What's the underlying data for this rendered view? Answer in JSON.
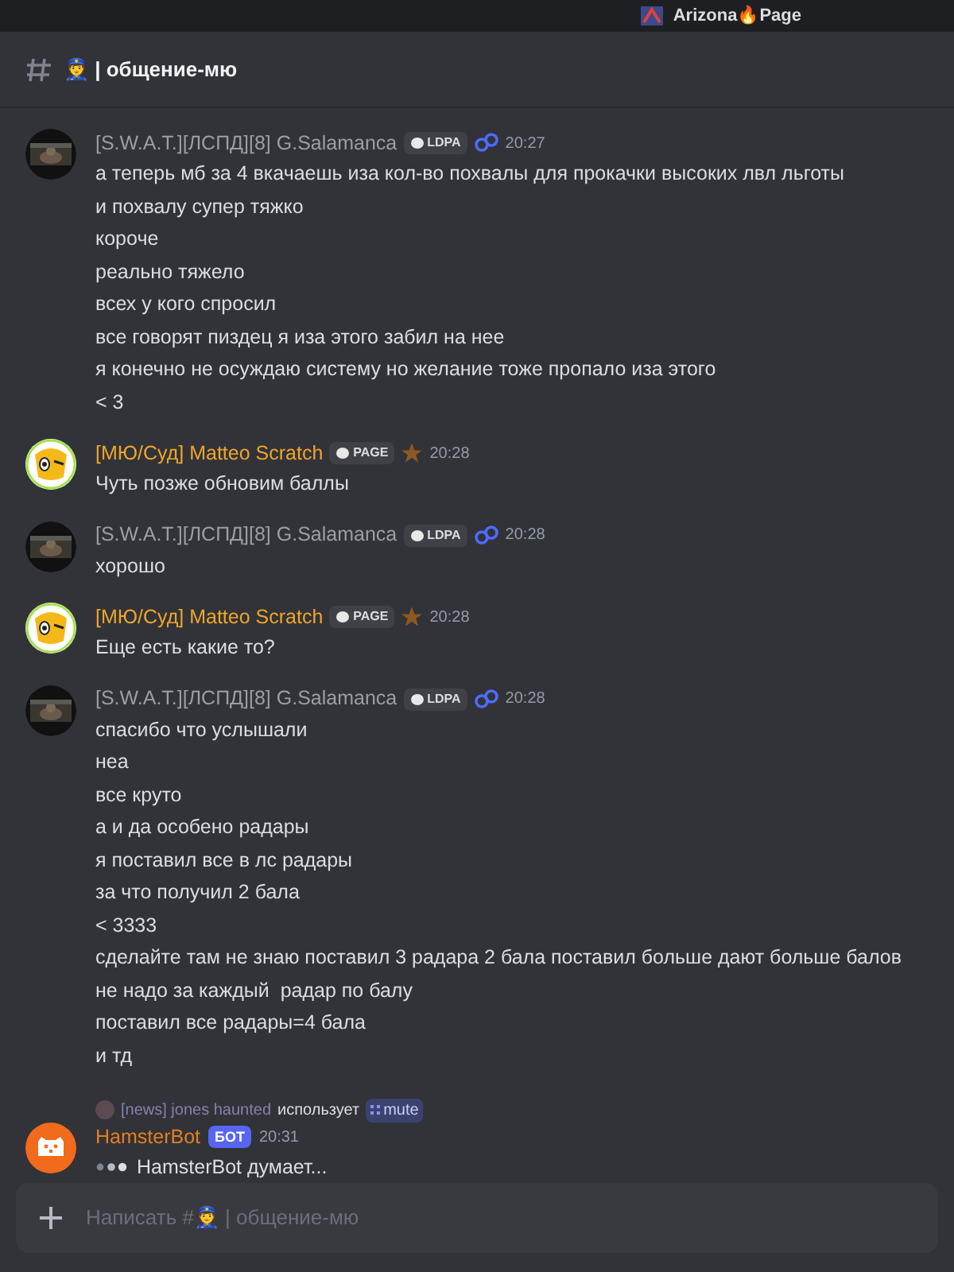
{
  "top_bar": {
    "server_name": "Arizona🔥Page"
  },
  "channel_header": {
    "title": "👮 | общение-мю"
  },
  "messages": [
    {
      "kind": "officer",
      "author": "[S.W.A.T.][ЛСПД][8] G.Salamanca",
      "badge": "LDPA",
      "time": "20:27",
      "lines": [
        "а теперь мб за 4 вкачаешь иза кол-во похвалы для прокачки высоких лвл льготы",
        "и похвалу супер тяжко",
        "короче",
        "реально тяжело",
        "всех у кого спросил",
        "все говорят пиздец я иза этого забил на нее",
        "я конечно не осуждаю систему но желание тоже пропало иза этого",
        "< 3"
      ]
    },
    {
      "kind": "judge",
      "author": "[МЮ/Суд] Matteo Scratch",
      "badge": "PAGE",
      "time": "20:28",
      "lines": [
        "Чуть позже обновим баллы"
      ]
    },
    {
      "kind": "officer",
      "author": "[S.W.A.T.][ЛСПД][8] G.Salamanca",
      "badge": "LDPA",
      "time": "20:28",
      "lines": [
        "хорошо"
      ]
    },
    {
      "kind": "judge",
      "author": "[МЮ/Суд] Matteo Scratch",
      "badge": "PAGE",
      "time": "20:28",
      "lines": [
        "Еще есть какие то?"
      ]
    },
    {
      "kind": "officer",
      "author": "[S.W.A.T.][ЛСПД][8] G.Salamanca",
      "badge": "LDPA",
      "time": "20:28",
      "lines": [
        "спасибо что услышали",
        "неа",
        "все круто",
        "а и да особено радары",
        "я поставил все в лс радары",
        "за что получил 2 бала",
        "< 3333",
        "сделайте там не знаю поставил 3 радара 2 бала поставил больше дают больше балов",
        "не надо за каждый  радар по балу",
        "поставил все радары=4 бала",
        "и тд"
      ]
    }
  ],
  "bot_message": {
    "reply": {
      "user": "[news] jones haunted",
      "action": "использует",
      "command": "mute"
    },
    "author": "HamsterBot",
    "tag": "БОТ",
    "time": "20:31",
    "typing": "HamsterBot думает..."
  },
  "composer": {
    "placeholder": "Написать #👮 | общение-мю"
  }
}
